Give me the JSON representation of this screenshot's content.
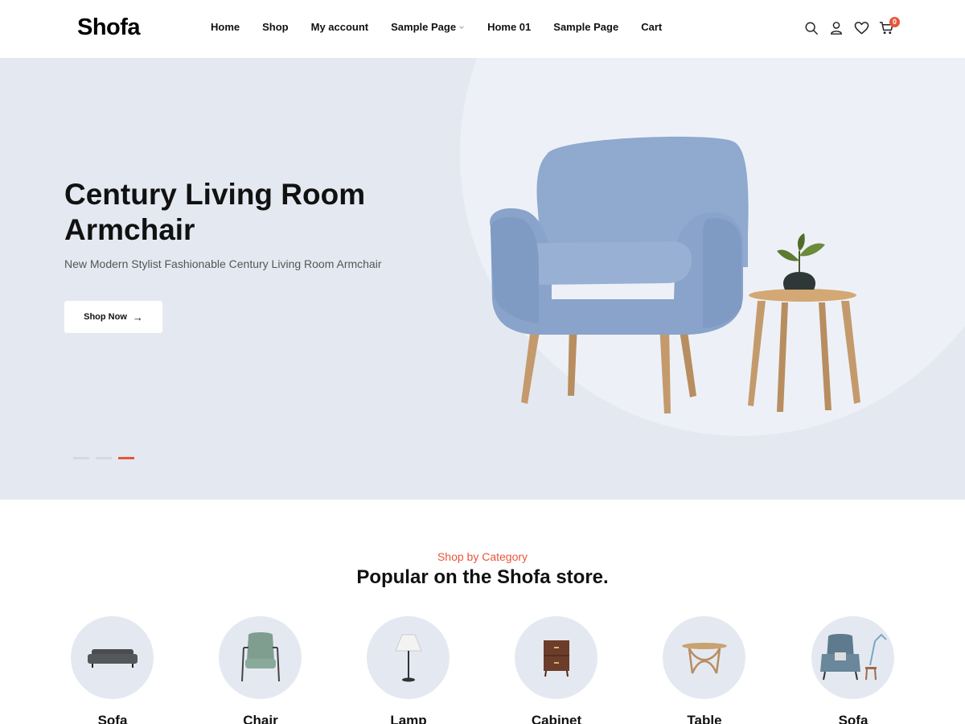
{
  "brand": {
    "name": "Shofa"
  },
  "nav": {
    "items": [
      {
        "label": "Home"
      },
      {
        "label": "Shop"
      },
      {
        "label": "My account"
      },
      {
        "label": "Sample Page",
        "has_dropdown": true
      },
      {
        "label": "Home 01"
      },
      {
        "label": "Sample Page"
      },
      {
        "label": "Cart"
      }
    ]
  },
  "header_icons": {
    "search": "search-icon",
    "account": "user-icon",
    "wishlist": "heart-icon",
    "cart": "cart-icon",
    "cart_count": "0"
  },
  "hero": {
    "title": "Century Living Room Armchair",
    "subtitle": "New Modern Stylist Fashionable Century Living Room Armchair",
    "button_label": "Shop Now",
    "button_icon": "arrow-right-icon",
    "slide_count": 3,
    "active_slide": 3
  },
  "categories": {
    "kicker": "Shop by Category",
    "title": "Popular on the Shofa store.",
    "items": [
      {
        "label": "Sofa",
        "icon": "sofa-icon"
      },
      {
        "label": "Chair",
        "icon": "chair-icon"
      },
      {
        "label": "Lamp",
        "icon": "lamp-icon"
      },
      {
        "label": "Cabinet",
        "icon": "cabinet-icon"
      },
      {
        "label": "Table",
        "icon": "table-icon"
      },
      {
        "label": "Sofa",
        "icon": "armchair-icon"
      }
    ]
  },
  "colors": {
    "accent": "#e8553a",
    "hero_bg": "#e4e9f1",
    "chair_blue": "#8fa9cf"
  }
}
